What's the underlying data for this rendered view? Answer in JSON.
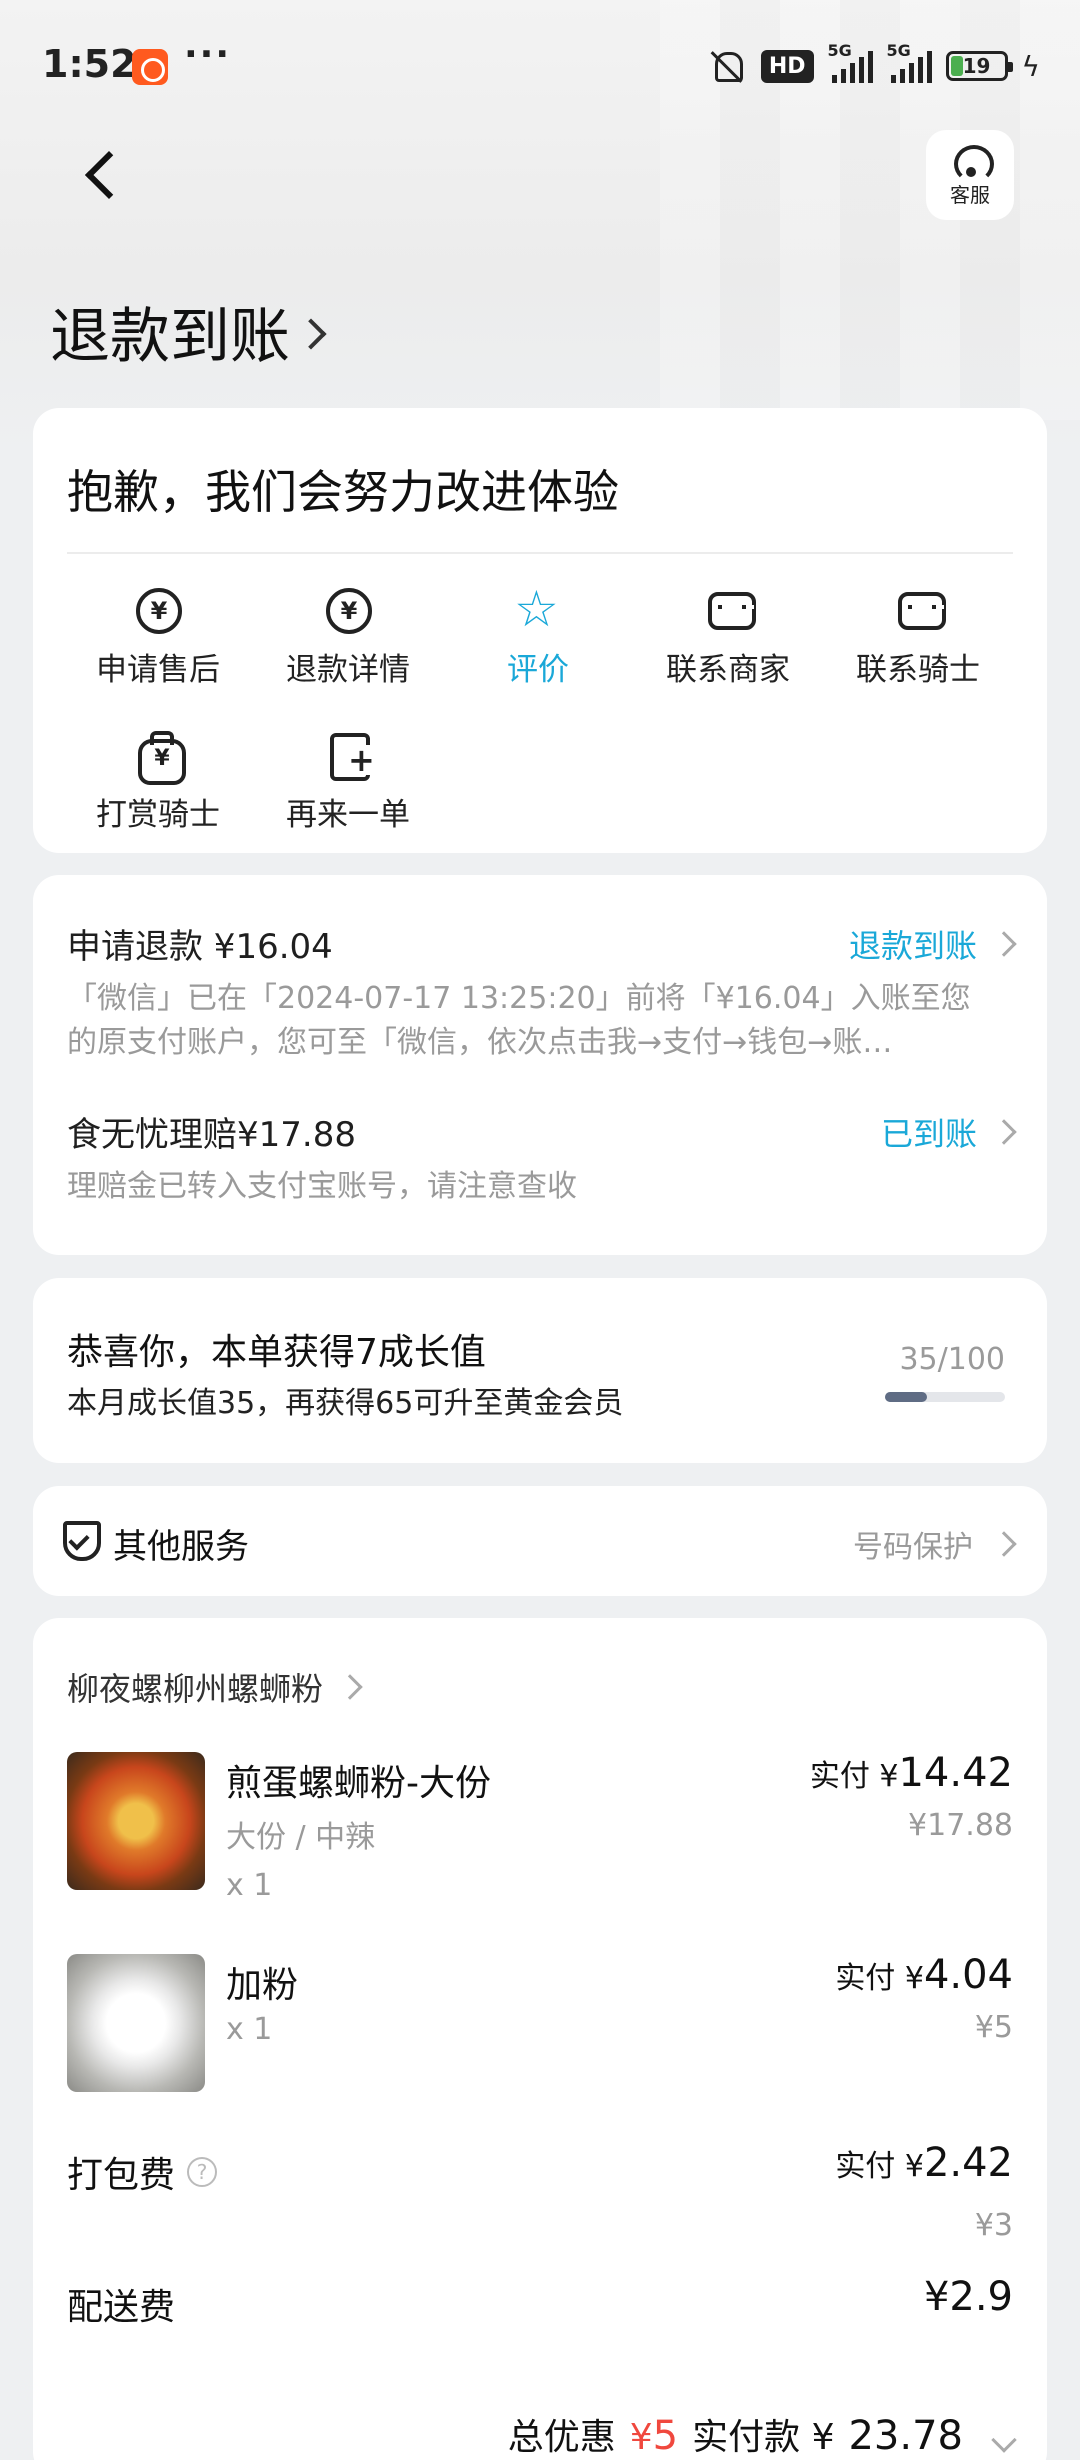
{
  "status_bar": {
    "time": "1:52",
    "hd": "HD",
    "net1": "5G",
    "net2": "5G",
    "battery": "19"
  },
  "header": {
    "customer_service_label": "客服",
    "title": "退款到账"
  },
  "feedback_card": {
    "title": "抱歉，我们会努力改进体验",
    "actions": [
      {
        "label": "申请售后",
        "icon": "yen-circle-icon"
      },
      {
        "label": "退款详情",
        "icon": "yen-refresh-icon"
      },
      {
        "label": "评价",
        "icon": "star-icon",
        "active": true
      },
      {
        "label": "联系商家",
        "icon": "chat-icon"
      },
      {
        "label": "联系骑士",
        "icon": "chat-icon"
      },
      {
        "label": "打赏骑士",
        "icon": "money-bag-icon"
      },
      {
        "label": "再来一单",
        "icon": "note-add-icon"
      }
    ]
  },
  "refund_card": {
    "refund_label": "申请退款 ¥16.04",
    "refund_status": "退款到账",
    "refund_desc_line1": "「微信」已在「2024-07-17 13:25:20」前将「¥16.04」入账至您",
    "refund_desc_line2": "的原支付账户，您可至「微信，依次点击我→支付→钱包→账…",
    "claim_label": "食无忧理赔¥17.88",
    "claim_status": "已到账",
    "claim_desc": "理赔金已转入支付宝账号，请注意查收"
  },
  "growth_card": {
    "title": "恭喜你，本单获得7成长值",
    "subtitle": "本月成长值35，再获得65可升至黄金会员",
    "progress_text": "35/100",
    "progress_fraction": 0.35
  },
  "services_card": {
    "title": "其他服务",
    "right_label": "号码保护"
  },
  "order_card": {
    "store_name": "柳夜螺柳州螺蛳粉",
    "items": [
      {
        "name": "煎蛋螺蛳粉-大份",
        "spec": "大份 / 中辣",
        "qty": "x 1",
        "paid_prefix": "实付 ¥",
        "paid": "14.42",
        "original": "¥17.88"
      },
      {
        "name": "加粉",
        "qty": "x 1",
        "paid_prefix": "实付 ¥",
        "paid": "4.04",
        "original": "¥5"
      }
    ],
    "packing_fee": {
      "label": "打包费",
      "paid_prefix": "实付 ¥",
      "paid": "2.42",
      "original": "¥3"
    },
    "delivery_fee": {
      "label": "配送费",
      "value": "¥2.9"
    },
    "total": {
      "discount_label": "总优惠",
      "discount_currency": "¥",
      "discount_value": "5",
      "paid_label": "实付款 ¥",
      "paid_value": "23.78"
    }
  },
  "colors": {
    "accent": "#1aa8d8",
    "discount_red": "#f0483e",
    "progress": "#5f6c84"
  }
}
